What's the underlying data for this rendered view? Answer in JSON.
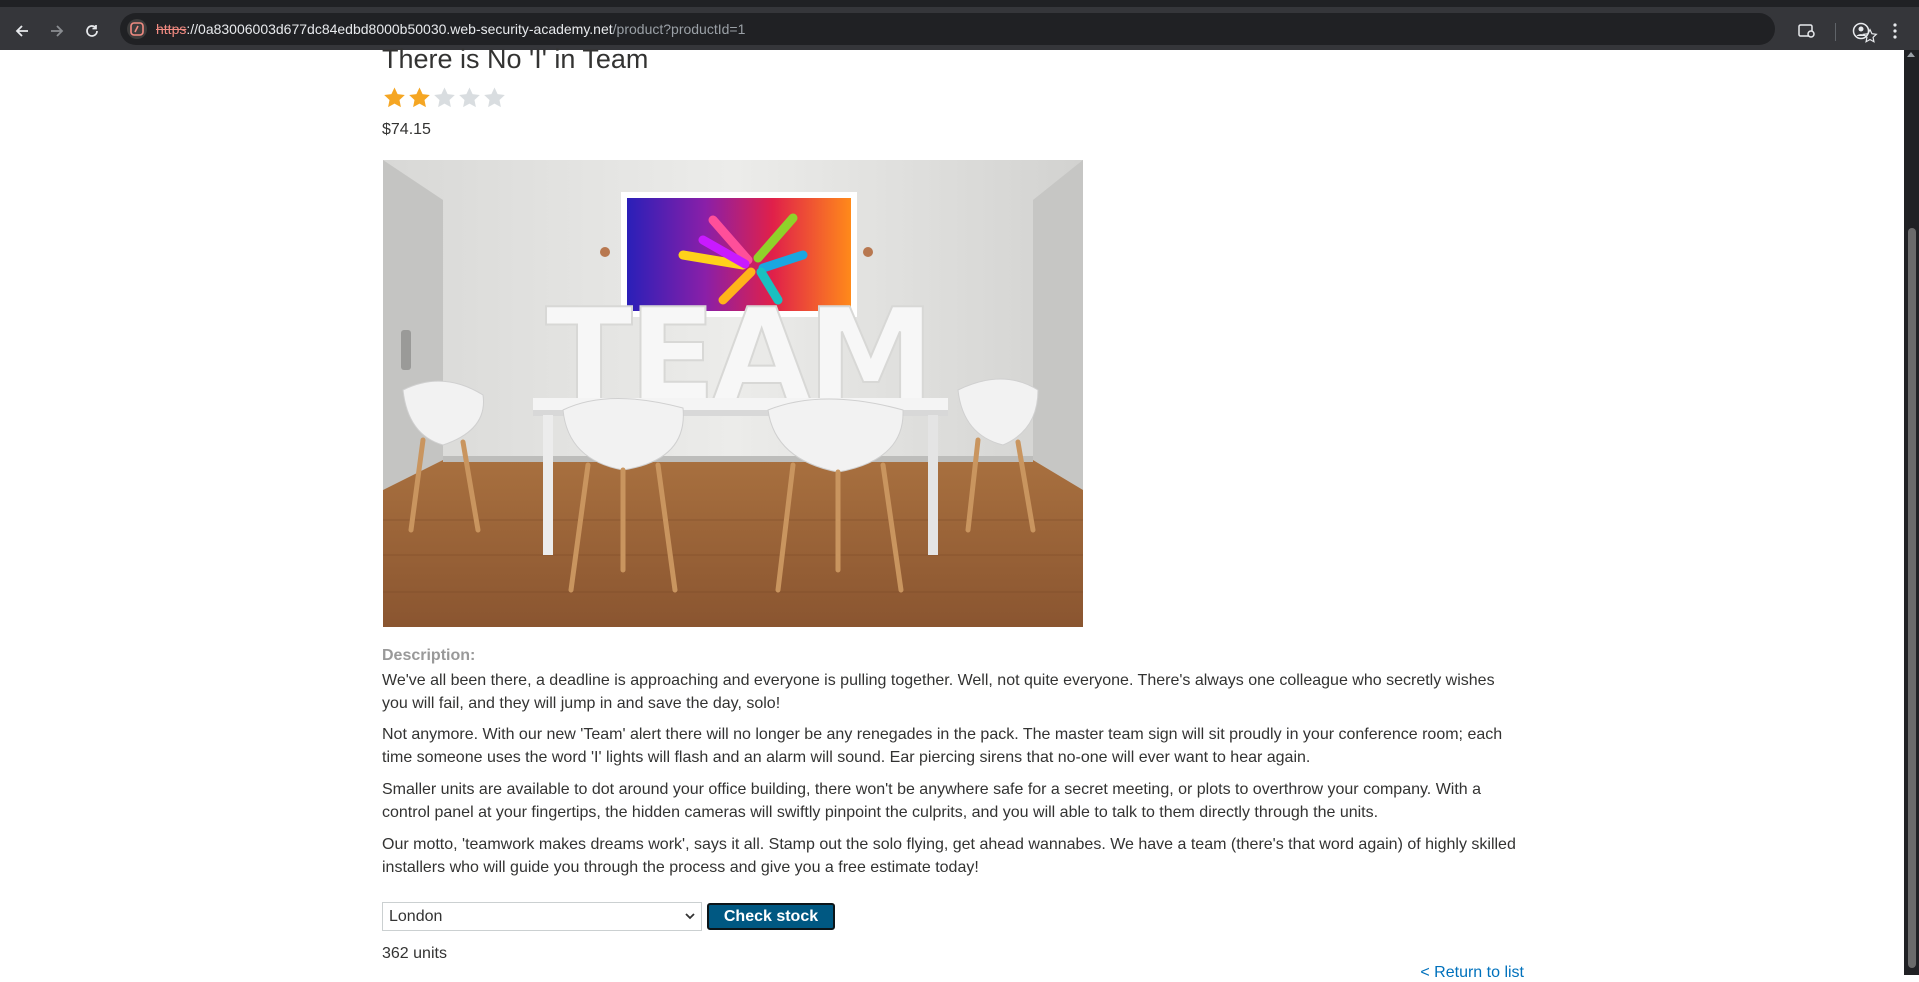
{
  "browser": {
    "url_scheme": "https",
    "url_host": "://0a83006003d677dc84edbd8000b50030.web-security-academy.net",
    "url_path": "/product?productId=1"
  },
  "product": {
    "title": "There is No 'I' in Team",
    "rating": 2,
    "rating_max": 5,
    "price": "$74.15",
    "image_text": "TEAM",
    "description_label": "Description:",
    "description": [
      "We've all been there, a deadline is approaching and everyone is pulling together. Well, not quite everyone. There's always one colleague who secretly wishes you will fail, and they will jump in and save the day, solo!",
      "Not anymore. With our new 'Team' alert there will no longer be any renegades in the pack. The master team sign will sit proudly in your conference room; each time someone uses the word 'I' lights will flash and an alarm will sound. Ear piercing sirens that no-one will ever want to hear again.",
      "Smaller units are available to dot around your office building, there won't be anywhere safe for a secret meeting, or plots to overthrow your company. With a control panel at your fingertips, the hidden cameras will swiftly pinpoint the culprits, and you will able to talk to them directly through the units.",
      "Our motto, 'teamwork makes dreams work', says it all. Stamp out the solo flying, get ahead wannabes. We have a team (there's that word again) of highly skilled installers who will guide you through the process and give you a free estimate today!"
    ]
  },
  "stock": {
    "selected_store": "London",
    "check_label": "Check stock",
    "result": "362 units"
  },
  "return_link": "< Return to list",
  "colors": {
    "star_filled": "#f5a623",
    "star_empty": "#d9dde0",
    "button_bg": "#005882",
    "link": "#0071bc"
  }
}
